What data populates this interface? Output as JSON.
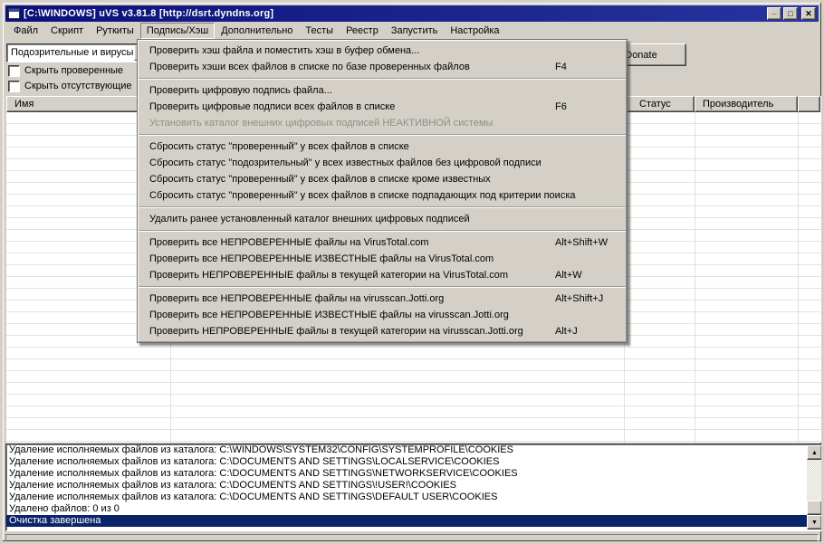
{
  "window": {
    "title": "[C:\\WINDOWS] uVS v3.81.8 [http://dsrt.dyndns.org]",
    "controls": [
      {
        "name": "minimize-button",
        "icon": "minimize-icon",
        "glyph": "_"
      },
      {
        "name": "maximize-button",
        "icon": "maximize-icon",
        "glyph": "□"
      },
      {
        "name": "close-button",
        "icon": "close-icon",
        "glyph": "✕"
      }
    ]
  },
  "menubar": {
    "items": [
      {
        "label": "Файл",
        "active": false
      },
      {
        "label": "Скрипт",
        "active": false
      },
      {
        "label": "Руткиты",
        "active": false
      },
      {
        "label": "Подпись/Хэш",
        "active": true
      },
      {
        "label": "Дополнительно",
        "active": false
      },
      {
        "label": "Тесты",
        "active": false
      },
      {
        "label": "Реестр",
        "active": false
      },
      {
        "label": "Запустить",
        "active": false
      },
      {
        "label": "Настройка",
        "active": false
      }
    ]
  },
  "menu": {
    "groups": [
      {
        "items": [
          {
            "label": "Проверить хэш файла и поместить хэш в буфер обмена...",
            "shortcut": "",
            "disabled": false
          },
          {
            "label": "Проверить хэши всех файлов в списке по базе проверенных файлов",
            "shortcut": "F4",
            "disabled": false
          }
        ]
      },
      {
        "items": [
          {
            "label": "Проверить цифровую подпись файла...",
            "shortcut": "",
            "disabled": false
          },
          {
            "label": "Проверить цифровые подписи всех файлов в списке",
            "shortcut": "F6",
            "disabled": false
          },
          {
            "label": "Установить каталог внешних цифровых подписей НЕАКТИВНОЙ системы",
            "shortcut": "",
            "disabled": true
          }
        ]
      },
      {
        "items": [
          {
            "label": "Сбросить статус \"проверенный\" у всех файлов в списке",
            "shortcut": "",
            "disabled": false
          },
          {
            "label": "Сбросить статус \"подозрительный\" у всех известных файлов без цифровой подписи",
            "shortcut": "",
            "disabled": false
          },
          {
            "label": "Сбросить статус \"проверенный\" у всех файлов в списке кроме известных",
            "shortcut": "",
            "disabled": false
          },
          {
            "label": "Сбросить статус \"проверенный\" у всех файлов в списке подпадающих под критерии поиска",
            "shortcut": "",
            "disabled": false
          }
        ]
      },
      {
        "items": [
          {
            "label": "Удалить ранее установленный каталог внешних цифровых подписей",
            "shortcut": "",
            "disabled": false
          }
        ]
      },
      {
        "items": [
          {
            "label": "Проверить все НЕПРОВЕРЕННЫЕ файлы на VirusTotal.com",
            "shortcut": "Alt+Shift+W",
            "disabled": false
          },
          {
            "label": "Проверить все НЕПРОВЕРЕННЫЕ ИЗВЕСТНЫЕ файлы на VirusTotal.com",
            "shortcut": "",
            "disabled": false
          },
          {
            "label": "Проверить НЕПРОВЕРЕННЫЕ файлы в текущей категории на VirusTotal.com",
            "shortcut": "Alt+W",
            "disabled": false
          }
        ]
      },
      {
        "items": [
          {
            "label": "Проверить все НЕПРОВЕРЕННЫЕ файлы на virusscan.Jotti.org",
            "shortcut": "Alt+Shift+J",
            "disabled": false
          },
          {
            "label": "Проверить все НЕПРОВЕРЕННЫЕ ИЗВЕСТНЫЕ файлы на virusscan.Jotti.org",
            "shortcut": "",
            "disabled": false
          },
          {
            "label": "Проверить НЕПРОВЕРЕННЫЕ файлы в текущей категории на virusscan.Jotti.org",
            "shortcut": "Alt+J",
            "disabled": false
          }
        ]
      }
    ]
  },
  "toolbar": {
    "category_select": {
      "value": "Подозрительные и вирусы"
    },
    "checkboxes": [
      {
        "label": "Скрыть проверенные",
        "checked": false
      },
      {
        "label": "Скрыть отсутствующие",
        "checked": false
      }
    ],
    "donate_label": "Donate"
  },
  "table": {
    "columns": [
      {
        "label": "Имя"
      },
      {
        "label": ""
      },
      {
        "label": "Статус"
      },
      {
        "label": "Производитель"
      },
      {
        "label": ""
      }
    ],
    "rows": []
  },
  "log": {
    "lines": [
      {
        "text": "Удаление исполняемых файлов из каталога: C:\\WINDOWS\\SYSTEM32\\CONFIG\\SYSTEMPROFILE\\COOKIES",
        "selected": false
      },
      {
        "text": "Удаление исполняемых файлов из каталога: C:\\DOCUMENTS AND SETTINGS\\LOCALSERVICE\\COOKIES",
        "selected": false
      },
      {
        "text": "Удаление исполняемых файлов из каталога: C:\\DOCUMENTS AND SETTINGS\\NETWORKSERVICE\\COOKIES",
        "selected": false
      },
      {
        "text": "Удаление исполняемых файлов из каталога: C:\\DOCUMENTS AND SETTINGS\\!USER!\\COOKIES",
        "selected": false
      },
      {
        "text": "Удаление исполняемых файлов из каталога: C:\\DOCUMENTS AND SETTINGS\\DEFAULT USER\\COOKIES",
        "selected": false
      },
      {
        "text": "Удалено файлов: 0 из 0",
        "selected": false
      },
      {
        "text": "Очистка завершена",
        "selected": true
      }
    ],
    "scrollbar": {
      "up_glyph": "▲",
      "down_glyph": "▼"
    }
  },
  "statusbar": {
    "text": ""
  },
  "colors": {
    "titlebar": "#0c1079",
    "face": "#d4d0c8",
    "selection": "#0a246a",
    "gridline": "#e4e4dc"
  }
}
